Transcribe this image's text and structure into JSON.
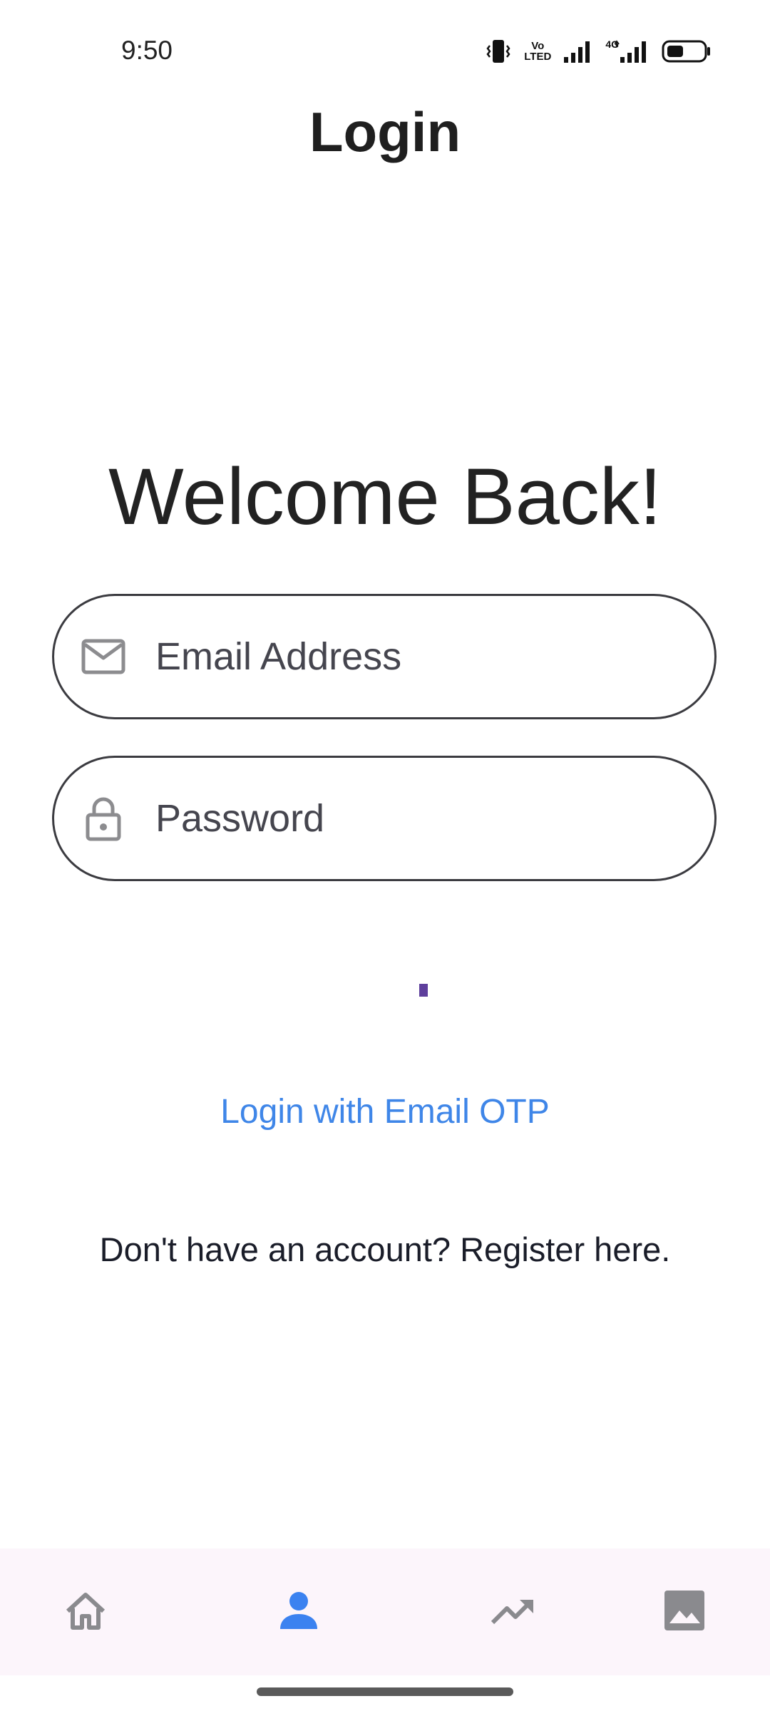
{
  "status_bar": {
    "time": "9:50",
    "volte_top": "Vo",
    "volte_bottom": "LTED",
    "network_type": "4G",
    "icons": [
      "vibrate-icon",
      "volte-icon",
      "signal-icon",
      "signal-4g-icon",
      "battery-icon"
    ]
  },
  "header": {
    "title": "Login"
  },
  "main": {
    "welcome": "Welcome Back!",
    "email": {
      "placeholder": "Email Address",
      "value": "",
      "icon": "mail-icon"
    },
    "password": {
      "placeholder": "Password",
      "value": "",
      "icon": "lock-icon"
    },
    "otp_link": "Login with Email OTP",
    "register_link": "Don't have an account? Register here."
  },
  "bottom_nav": {
    "items": [
      {
        "name": "home",
        "icon": "home-icon",
        "active": false
      },
      {
        "name": "profile",
        "icon": "person-icon",
        "active": true
      },
      {
        "name": "trends",
        "icon": "trending-up-icon",
        "active": false
      },
      {
        "name": "gallery",
        "icon": "image-icon",
        "active": false
      }
    ]
  },
  "colors": {
    "link": "#3f86e8",
    "nav_active": "#3b82f0",
    "nav_inactive": "#8a8a8e",
    "nav_background": "#fcf5fb",
    "field_border": "#3b3b40",
    "spinner": "#5e3f9c"
  }
}
